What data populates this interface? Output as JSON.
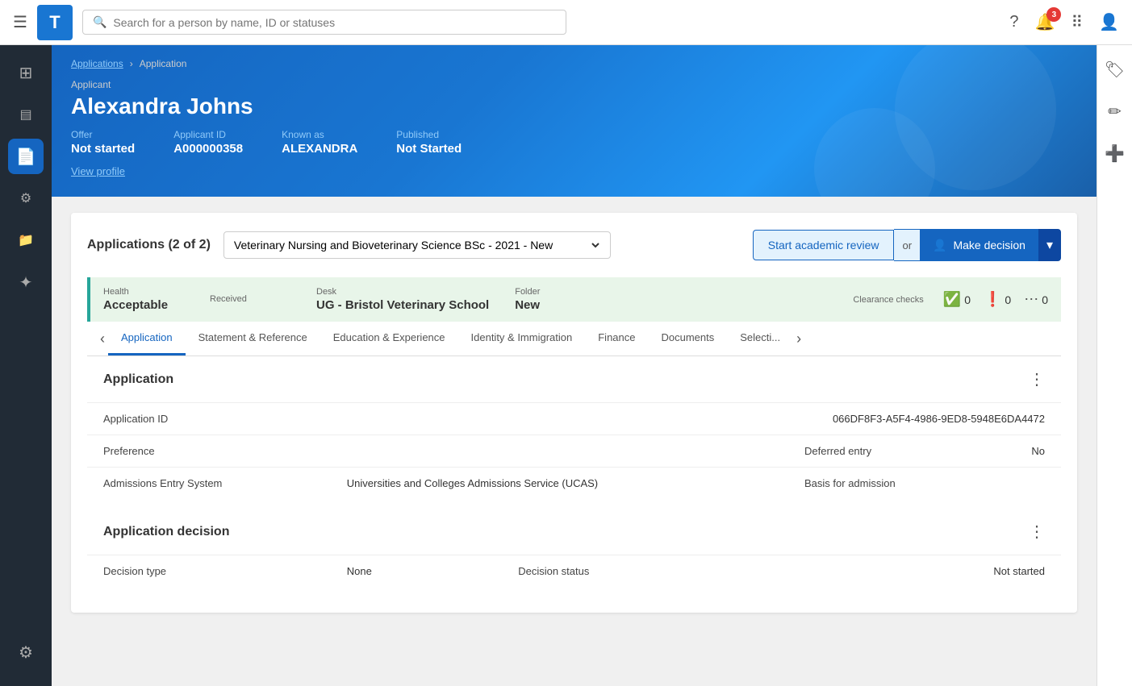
{
  "topNav": {
    "logoLetter": "T",
    "searchPlaceholder": "Search for a person by name, ID or statuses",
    "notificationCount": "3"
  },
  "sidebar": {
    "items": [
      {
        "id": "grid",
        "icon": "⊞",
        "active": false
      },
      {
        "id": "template",
        "icon": "▤",
        "active": false
      },
      {
        "id": "document",
        "icon": "📄",
        "active": true
      },
      {
        "id": "filter",
        "icon": "⚙",
        "active": false
      },
      {
        "id": "file-upload",
        "icon": "📁",
        "active": false
      },
      {
        "id": "person",
        "icon": "✦",
        "active": false
      }
    ],
    "settingsIcon": "⚙"
  },
  "breadcrumb": {
    "applicationsLabel": "Applications",
    "separator": "›",
    "currentLabel": "Application"
  },
  "header": {
    "applicantLabel": "Applicant",
    "applicantName": "Alexandra Johns",
    "offer": {
      "label": "Offer",
      "value": "Not started"
    },
    "applicantId": {
      "label": "Applicant ID",
      "value": "A000000358"
    },
    "knownAs": {
      "label": "Known as",
      "value": "ALEXANDRA"
    },
    "published": {
      "label": "Published",
      "value": "Not Started"
    },
    "viewProfileLabel": "View profile"
  },
  "applicationsCard": {
    "title": "Applications (2 of 2)",
    "dropdownValue": "Veterinary Nursing and Bioveterinary Science BSc - 2021 - New",
    "academicReviewLabel": "Start academic review",
    "orLabel": "or",
    "makeDecisionLabel": "Make decision"
  },
  "statusBar": {
    "healthLabel": "Health",
    "healthValue": "Acceptable",
    "receivedLabel": "Received",
    "receivedValue": "",
    "deskLabel": "Desk",
    "deskValue": "UG - Bristol Veterinary School",
    "folderLabel": "Folder",
    "folderValue": "New",
    "clearanceLabel": "Clearance checks",
    "clearanceItems": [
      {
        "icon": "check",
        "count": "0"
      },
      {
        "icon": "warn",
        "count": "0"
      },
      {
        "icon": "more",
        "count": "0"
      }
    ]
  },
  "tabs": {
    "items": [
      {
        "label": "Application",
        "active": true
      },
      {
        "label": "Statement & Reference",
        "active": false
      },
      {
        "label": "Education & Experience",
        "active": false
      },
      {
        "label": "Identity & Immigration",
        "active": false
      },
      {
        "label": "Finance",
        "active": false
      },
      {
        "label": "Documents",
        "active": false
      },
      {
        "label": "Selecti...",
        "active": false
      }
    ]
  },
  "applicationSection": {
    "title": "Application",
    "fields": [
      {
        "label": "Application ID",
        "value": "066DF8F3-A5F4-4986-9ED8-5948E6DA4472",
        "fullRow": true
      },
      {
        "label": "Preference",
        "value": "",
        "paired": {
          "label": "Deferred entry",
          "value": "No"
        }
      },
      {
        "label": "Admissions Entry System",
        "value": "Universities and Colleges Admissions Service (UCAS)",
        "paired": {
          "label": "Basis for admission",
          "value": ""
        }
      }
    ]
  },
  "decisionSection": {
    "title": "Application decision",
    "fields": [
      {
        "label": "Decision type",
        "value": "None",
        "paired": {
          "label": "Decision status",
          "value": "Not started"
        }
      }
    ]
  },
  "rightPanel": {
    "icons": [
      "🏷",
      "✏",
      "➕"
    ]
  }
}
